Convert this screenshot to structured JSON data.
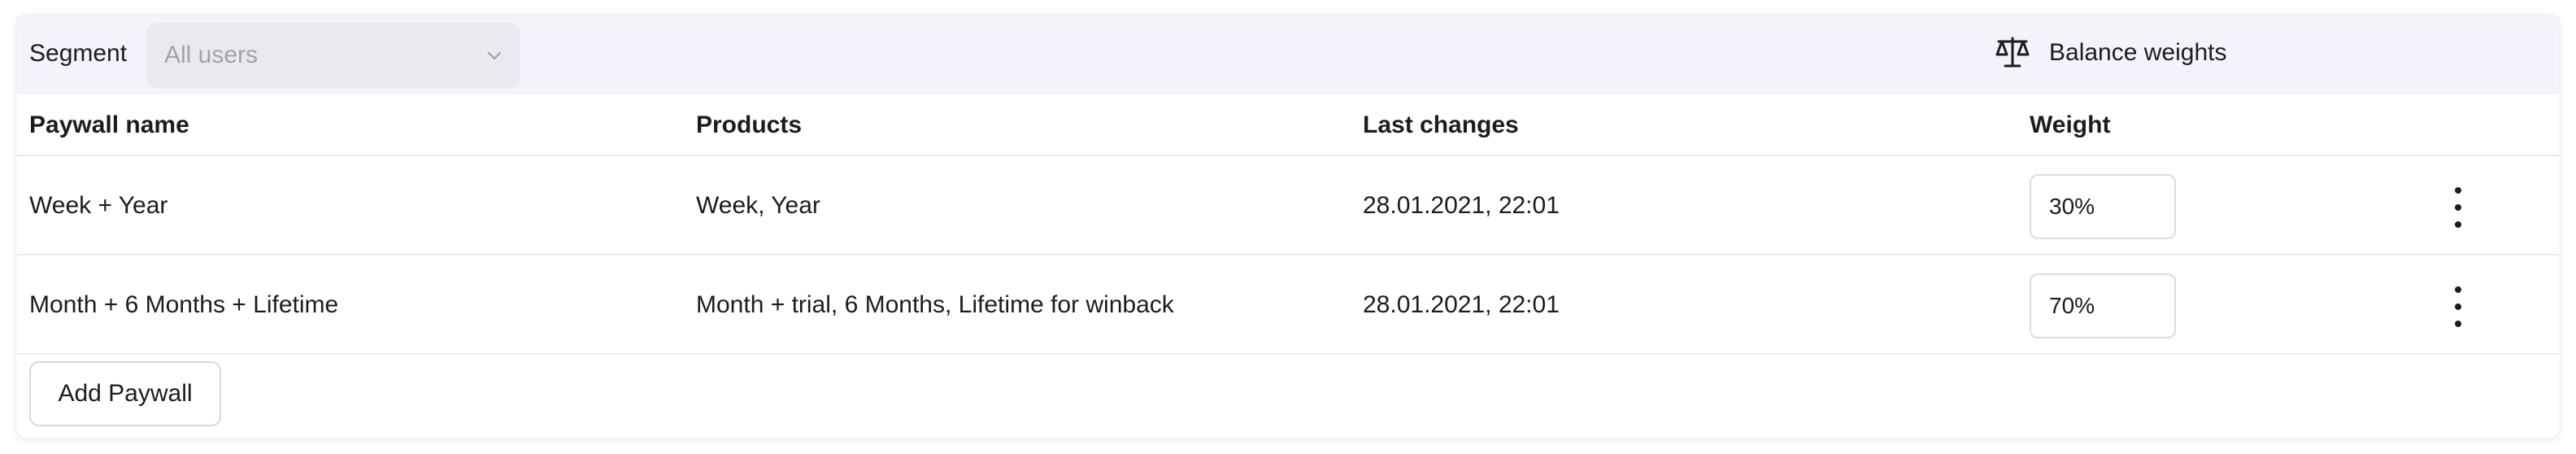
{
  "toolbar": {
    "segment_label": "Segment",
    "segment_value": "All users",
    "balance_label": "Balance weights"
  },
  "table": {
    "columns": [
      "Paywall name",
      "Products",
      "Last changes",
      "Weight"
    ],
    "rows": [
      {
        "name": "Week + Year",
        "products": "Week, Year",
        "last_changes": "28.01.2021, 22:01",
        "weight": "30%"
      },
      {
        "name": "Month + 6 Months + Lifetime",
        "products": "Month + trial, 6 Months, Lifetime for winback",
        "last_changes": "28.01.2021, 22:01",
        "weight": "70%"
      }
    ]
  },
  "footer": {
    "add_label": "Add Paywall"
  },
  "icons": {
    "balance": "scale-icon",
    "dropdown": "chevron-down-icon",
    "row_menu": "more-vertical-icon"
  }
}
